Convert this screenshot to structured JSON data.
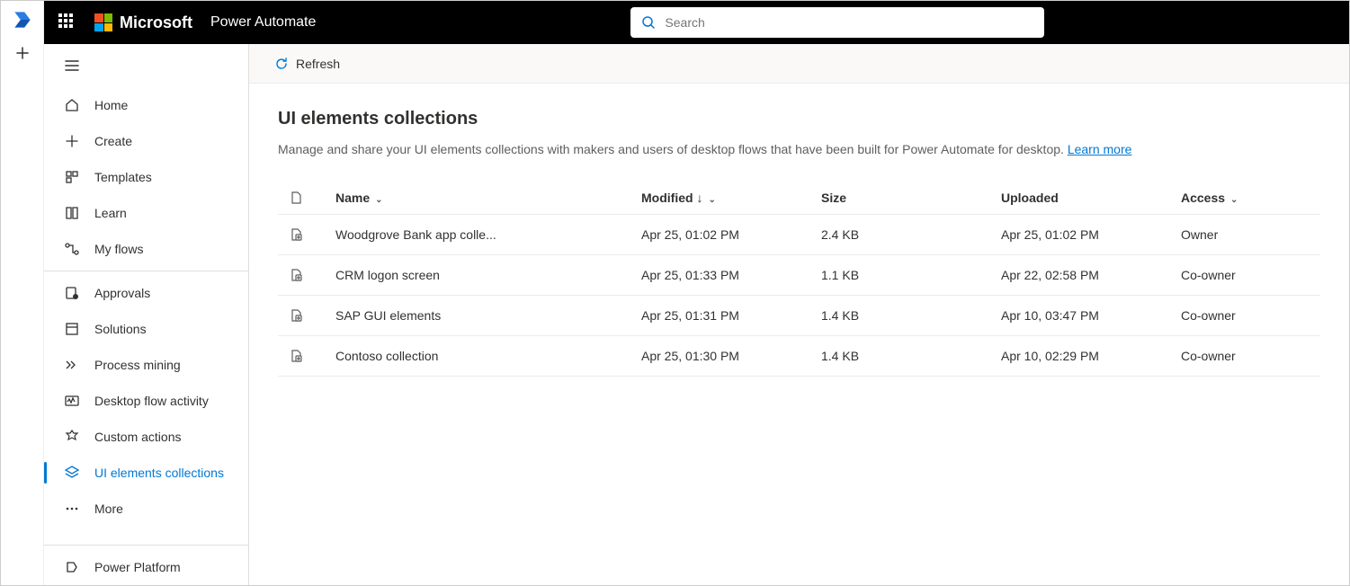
{
  "topbar": {
    "brand": "Microsoft",
    "product": "Power Automate",
    "search_placeholder": "Search"
  },
  "sidebar": {
    "items": [
      {
        "label": "Home"
      },
      {
        "label": "Create"
      },
      {
        "label": "Templates"
      },
      {
        "label": "Learn"
      },
      {
        "label": "My flows"
      },
      {
        "label": "Approvals"
      },
      {
        "label": "Solutions"
      },
      {
        "label": "Process mining"
      },
      {
        "label": "Desktop flow activity"
      },
      {
        "label": "Custom actions"
      },
      {
        "label": "UI elements collections"
      },
      {
        "label": "More"
      }
    ],
    "footer": {
      "label": "Power Platform"
    }
  },
  "cmdbar": {
    "refresh": "Refresh"
  },
  "page": {
    "title": "UI elements collections",
    "desc": "Manage and share your UI elements collections with makers and users of desktop flows that have been built for Power Automate for desktop. ",
    "learn_more": "Learn more"
  },
  "table": {
    "headers": {
      "name": "Name",
      "modified": "Modified",
      "size": "Size",
      "uploaded": "Uploaded",
      "access": "Access"
    },
    "rows": [
      {
        "name": "Woodgrove Bank app colle...",
        "modified": "Apr 25, 01:02 PM",
        "size": "2.4 KB",
        "uploaded": "Apr 25, 01:02 PM",
        "access": "Owner"
      },
      {
        "name": "CRM logon screen",
        "modified": "Apr 25, 01:33 PM",
        "size": "1.1 KB",
        "uploaded": "Apr 22, 02:58 PM",
        "access": "Co-owner"
      },
      {
        "name": "SAP GUI elements",
        "modified": "Apr 25, 01:31 PM",
        "size": "1.4 KB",
        "uploaded": "Apr 10, 03:47 PM",
        "access": "Co-owner"
      },
      {
        "name": "Contoso collection",
        "modified": "Apr 25, 01:30 PM",
        "size": "1.4 KB",
        "uploaded": "Apr 10, 02:29 PM",
        "access": "Co-owner"
      }
    ]
  }
}
